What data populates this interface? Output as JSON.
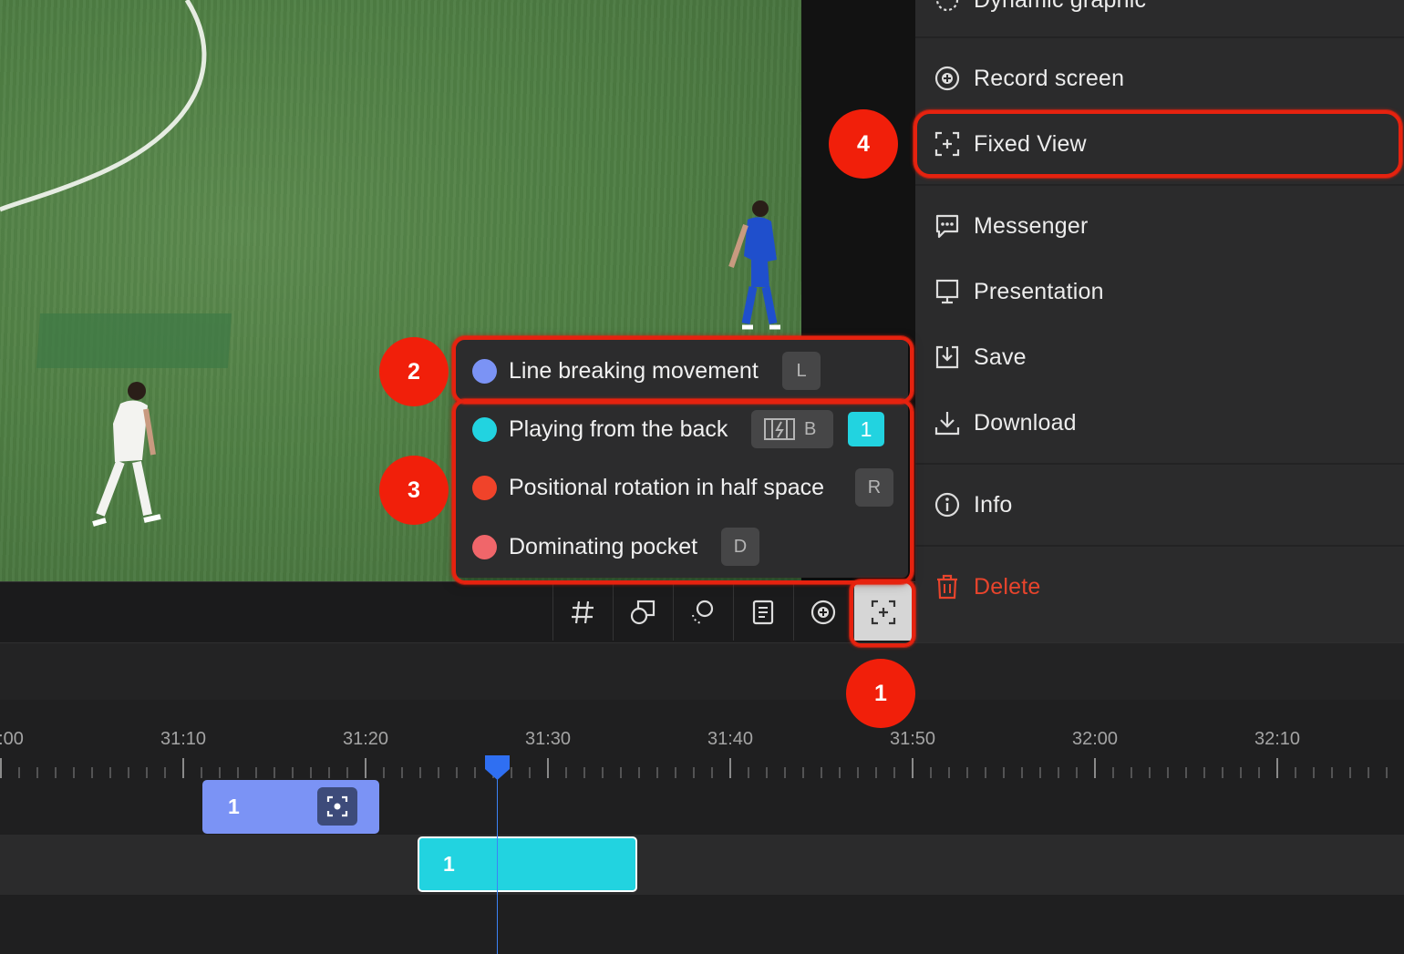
{
  "side_menu": {
    "items": [
      {
        "label": "Dynamic graphic",
        "icon": "dynamic-graphic-icon"
      },
      {
        "label": "Record screen",
        "icon": "record-screen-icon"
      },
      {
        "label": "Fixed View",
        "icon": "fixed-view-icon"
      },
      {
        "label": "Messenger",
        "icon": "messenger-icon"
      },
      {
        "label": "Presentation",
        "icon": "presentation-icon"
      },
      {
        "label": "Save",
        "icon": "save-icon"
      },
      {
        "label": "Download",
        "icon": "download-icon"
      },
      {
        "label": "Info",
        "icon": "info-icon"
      },
      {
        "label": "Delete",
        "icon": "trash-icon",
        "color": "#e8442c"
      }
    ]
  },
  "tag_popup": {
    "tags": [
      {
        "label": "Line breaking movement",
        "color": "#7b93f5",
        "key": "L"
      },
      {
        "label": "Playing from the back",
        "color": "#22d3e0",
        "key": "B",
        "count": "1"
      },
      {
        "label": "Positional rotation in half space",
        "color": "#f0432a",
        "key": "R"
      },
      {
        "label": "Dominating pocket",
        "color": "#f0666a",
        "key": "D"
      }
    ]
  },
  "toolbar": {
    "buttons": [
      "hashtag-icon",
      "shapes-icon",
      "dynamic-graphic-icon",
      "notes-icon",
      "record-icon",
      "fixed-view-icon"
    ],
    "active": "fixed-view-icon"
  },
  "timeline": {
    "ticks": [
      ":00",
      "31:10",
      "31:20",
      "31:30",
      "31:40",
      "31:50",
      "32:00",
      "32:10"
    ],
    "clips": [
      {
        "label": "1",
        "color": "#7b93f5",
        "icon": "focus-icon"
      },
      {
        "label": "1",
        "color": "#22d3e0"
      }
    ],
    "playhead_color": "#3b82f6"
  },
  "annotations": {
    "badges": [
      "1",
      "2",
      "3",
      "4"
    ],
    "color": "#f11f0a"
  }
}
